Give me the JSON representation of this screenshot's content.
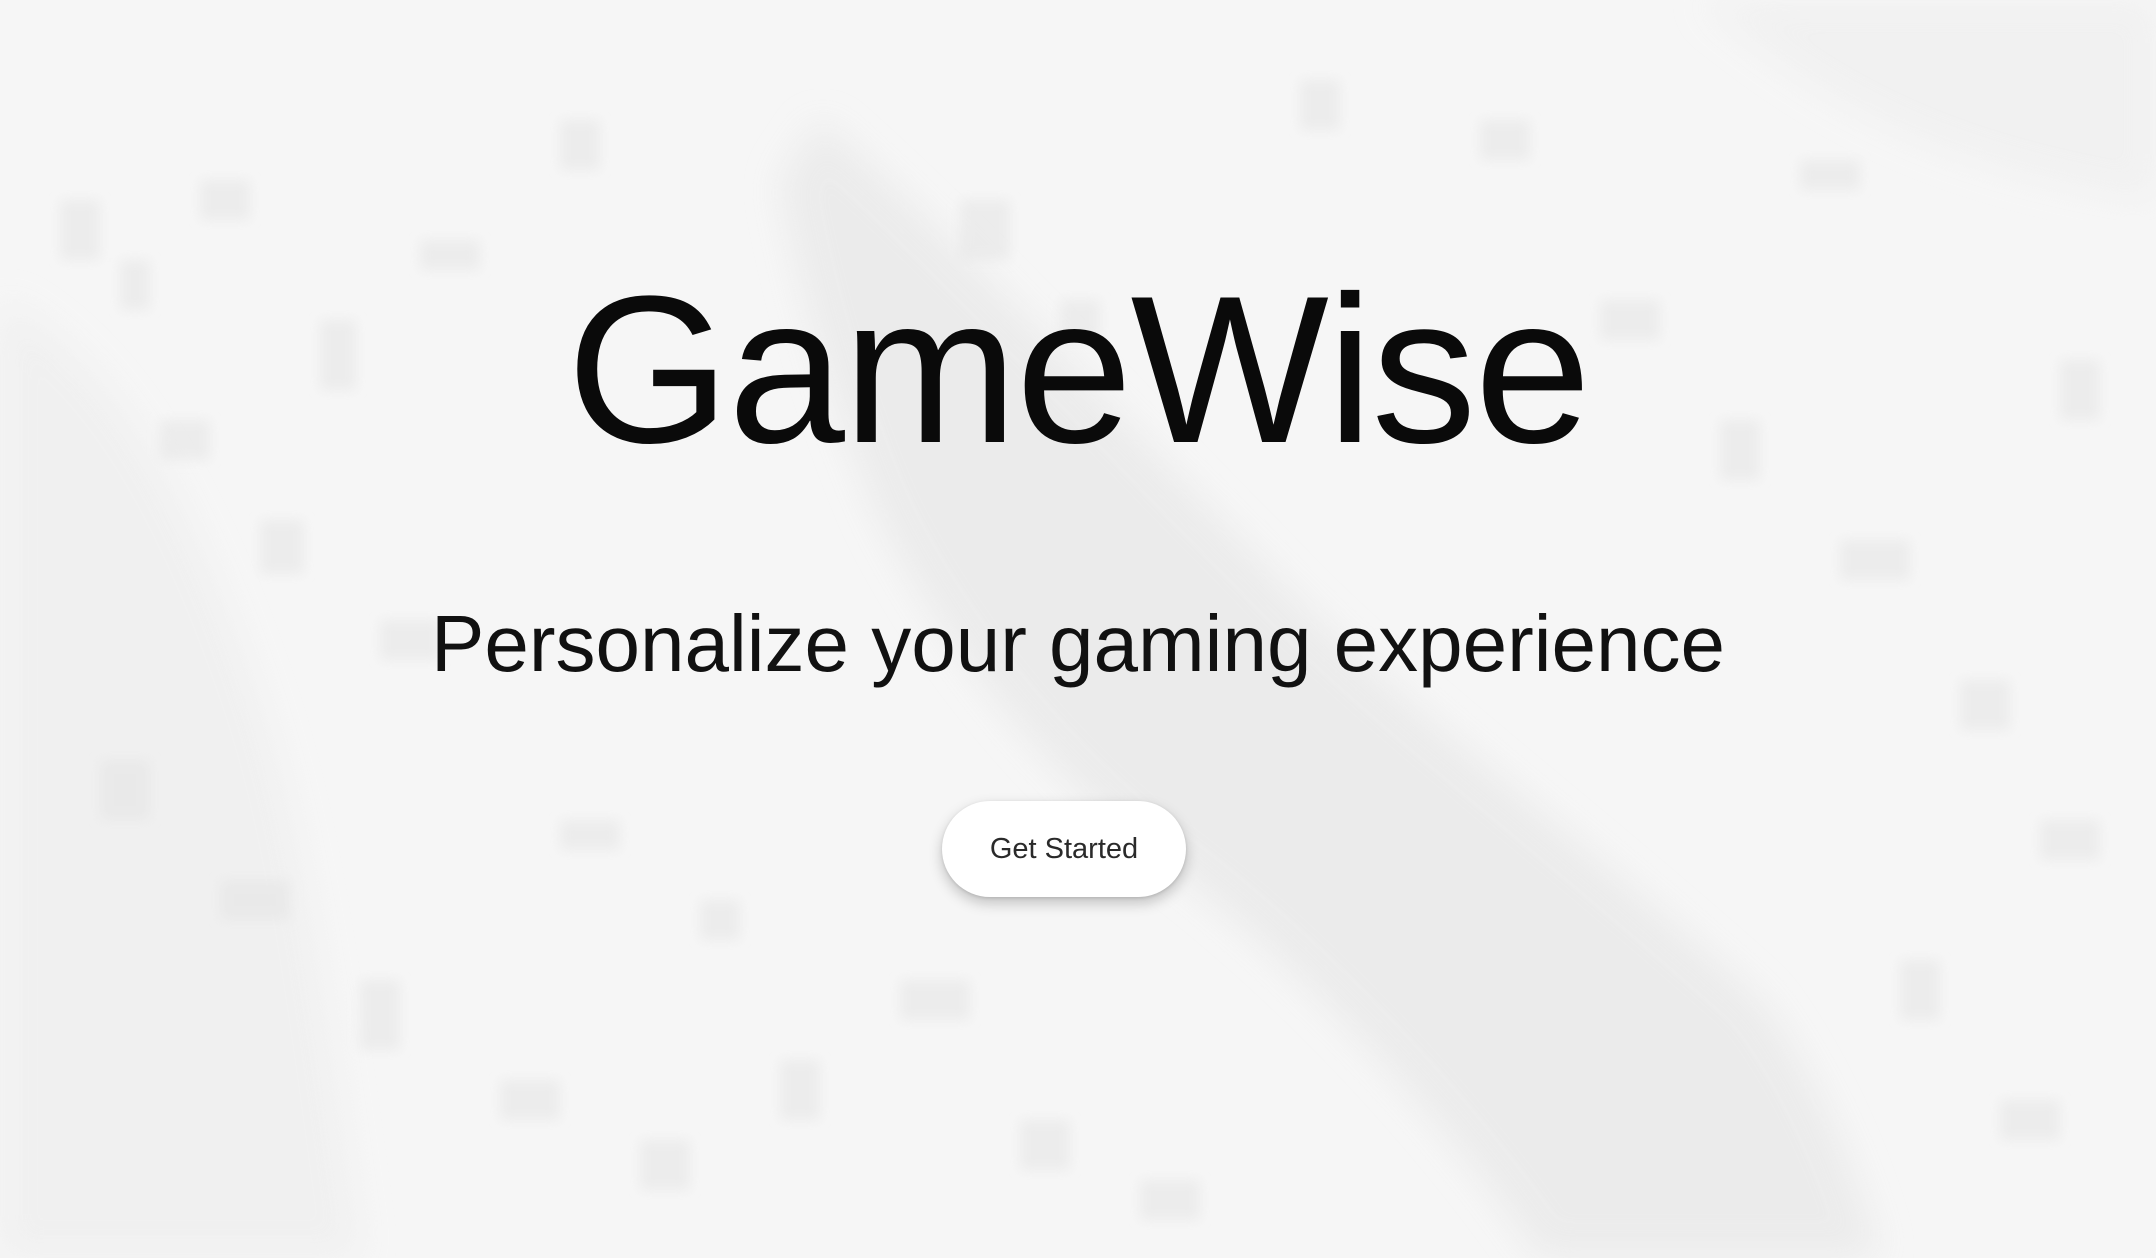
{
  "hero": {
    "title": "GameWise",
    "subtitle": "Personalize your gaming experience",
    "cta_label": "Get Started",
    "background_image": "faded aerial city photo"
  },
  "colors": {
    "background": "#f6f6f6",
    "text": "#0a0a0a",
    "button_bg": "#ffffff",
    "button_text": "#2a2a2a"
  }
}
